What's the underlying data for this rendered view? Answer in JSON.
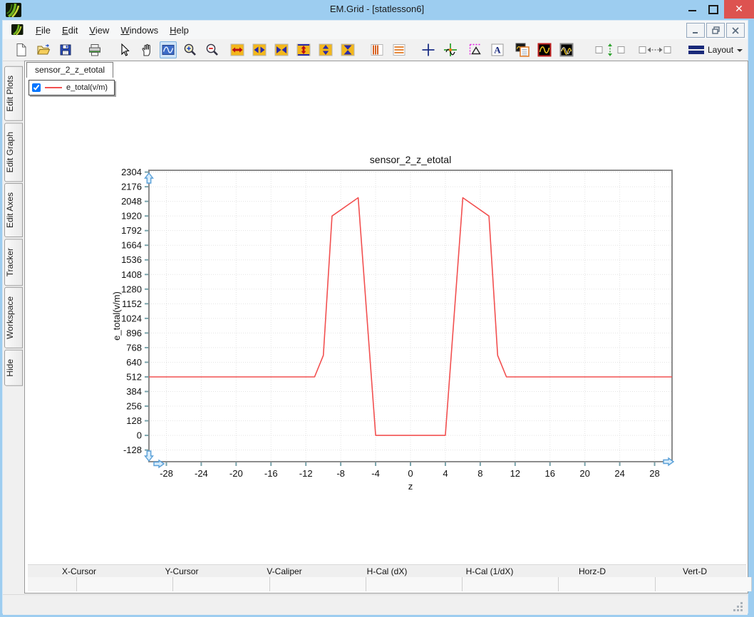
{
  "window": {
    "title": "EM.Grid - [statlesson6]",
    "controls": {
      "minimize": "minimize",
      "maximize": "maximize",
      "close": "✕"
    }
  },
  "menu": {
    "items": [
      "File",
      "Edit",
      "View",
      "Windows",
      "Help"
    ]
  },
  "mdi_controls": {
    "minimize": "minimize",
    "restore": "restore",
    "close": "close"
  },
  "toolbar": {
    "layout_label": "Layout",
    "icons": [
      "new-document",
      "open-file",
      "save",
      "print",
      "pointer",
      "pan-hand",
      "box-zoom",
      "zoom-in",
      "zoom-out",
      "expand-x",
      "stretch-x",
      "shrink-x",
      "expand-y",
      "stretch-y",
      "shrink-y",
      "vertical-markers",
      "horizontal-markers",
      "crosshair",
      "tracker",
      "caliper",
      "text-label",
      "legend-list",
      "single-trace",
      "multi-trace",
      "align-vertical",
      "align-horizontal",
      "layout-menu"
    ]
  },
  "sidebar": {
    "tabs": [
      "Edit Plots",
      "Edit Graph",
      "Edit Axes",
      "Tracker",
      "Workspace",
      "Hide"
    ]
  },
  "document_tab": "sensor_2_z_etotal",
  "legend": {
    "checked": true,
    "label": "e_total(v/m)",
    "line_color": "#f25050"
  },
  "chart_data": {
    "type": "line",
    "title": "sensor_2_z_etotal",
    "xlabel": "z",
    "ylabel": "e_total(v/m)",
    "xlim": [
      -30,
      30
    ],
    "ylim": [
      -230,
      2320
    ],
    "x_ticks": [
      -28,
      -24,
      -20,
      -16,
      -12,
      -8,
      -4,
      0,
      4,
      8,
      12,
      16,
      20,
      24,
      28
    ],
    "y_ticks": [
      2304,
      2176,
      2048,
      1920,
      1792,
      1664,
      1536,
      1408,
      1280,
      1152,
      1024,
      896,
      768,
      640,
      512,
      384,
      256,
      128,
      0,
      -128
    ],
    "grid": true,
    "legend_position": "top-left",
    "series": [
      {
        "name": "e_total(v/m)",
        "color": "#f25050",
        "points": [
          [
            -30,
            512
          ],
          [
            -11,
            512
          ],
          [
            -10,
            700
          ],
          [
            -9,
            1920
          ],
          [
            -6,
            2080
          ],
          [
            -4,
            0
          ],
          [
            4,
            0
          ],
          [
            6,
            2080
          ],
          [
            9,
            1920
          ],
          [
            10,
            700
          ],
          [
            11,
            512
          ],
          [
            30,
            512
          ]
        ]
      }
    ]
  },
  "readout_bar": {
    "headers": [
      "X-Cursor",
      "Y-Cursor",
      "V-Caliper",
      "H-Cal (dX)",
      "H-Cal (1/dX)",
      "Horz-D",
      "Vert-D"
    ],
    "values": [
      "",
      "",
      "",
      "",
      "",
      "",
      ""
    ]
  },
  "colors": {
    "titlebar": "#9dcdf0",
    "close_button": "#dd5350",
    "series": "#f25050",
    "selection": "#cfe4f7"
  }
}
